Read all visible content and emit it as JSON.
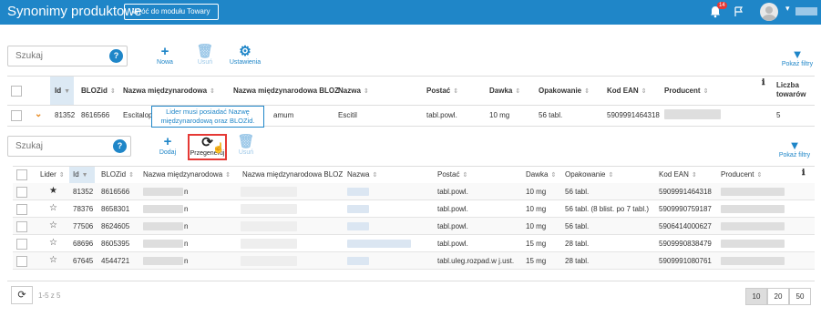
{
  "header": {
    "title": "Synonimy produktowe",
    "back_button": "Wróć do modułu Towary",
    "notification_count": "14"
  },
  "main": {
    "search_placeholder": "Szukaj",
    "toolbar": {
      "add": "Nowa",
      "delete": "Usuń",
      "settings": "Ustawienia"
    },
    "filters": "Pokaż filtry",
    "columns": [
      "Id",
      "BLOZid",
      "Nazwa międzynarodowa",
      "Nazwa międzynarodowa BLOZ",
      "Nazwa",
      "Postać",
      "Dawka",
      "Opakowanie",
      "Kod EAN",
      "Producent",
      "Liczba towarów"
    ],
    "row": {
      "id": "81352",
      "bloz": "8616566",
      "intl_name": "Escitalopr",
      "intl_bloz": "amum",
      "name": "Escitil",
      "form": "tabl.powl.",
      "dose": "10 mg",
      "pack": "56 tabl.",
      "ean": "5909991464318",
      "count": "5"
    }
  },
  "sub": {
    "search_placeholder": "Szukaj",
    "toolbar": {
      "add": "Dodaj",
      "regenerate": "Przegeneruj",
      "delete": "Usuń"
    },
    "filters": "Pokaż filtry",
    "tooltip": "Lider musi posiadać Nazwę międzynarodową oraz BLOZid.",
    "columns": [
      "Lider",
      "Id",
      "BLOZid",
      "Nazwa międzynarodowa",
      "Nazwa międzynarodowa BLOZ",
      "Nazwa",
      "Postać",
      "Dawka",
      "Opakowanie",
      "Kod EAN",
      "Producent"
    ],
    "rows": [
      {
        "leader": "★",
        "id": "81352",
        "bloz": "8616566",
        "intl_tail": "n",
        "form": "tabl.powl.",
        "dose": "10 mg",
        "pack": "56 tabl.",
        "ean": "5909991464318"
      },
      {
        "leader": "☆",
        "id": "78376",
        "bloz": "8658301",
        "intl_tail": "n",
        "form": "tabl.powl.",
        "dose": "10 mg",
        "pack": "56 tabl. (8 blist. po 7 tabl.)",
        "ean": "5909990759187"
      },
      {
        "leader": "☆",
        "id": "77506",
        "bloz": "8624605",
        "intl_tail": "n",
        "form": "tabl.powl.",
        "dose": "10 mg",
        "pack": "56 tabl.",
        "ean": "5906414000627"
      },
      {
        "leader": "☆",
        "id": "68696",
        "bloz": "8605395",
        "intl_tail": "n",
        "form": "tabl.powl.",
        "dose": "15 mg",
        "pack": "28 tabl.",
        "ean": "5909990838479"
      },
      {
        "leader": "☆",
        "id": "67645",
        "bloz": "4544721",
        "intl_tail": "n",
        "form": "tabl.uleg.rozpad.w j.ust.",
        "dose": "15 mg",
        "pack": "28 tabl.",
        "ean": "5909991080761"
      }
    ],
    "pagination": {
      "info": "1-5 z 5",
      "sizes": [
        "10",
        "20",
        "50"
      ]
    }
  }
}
